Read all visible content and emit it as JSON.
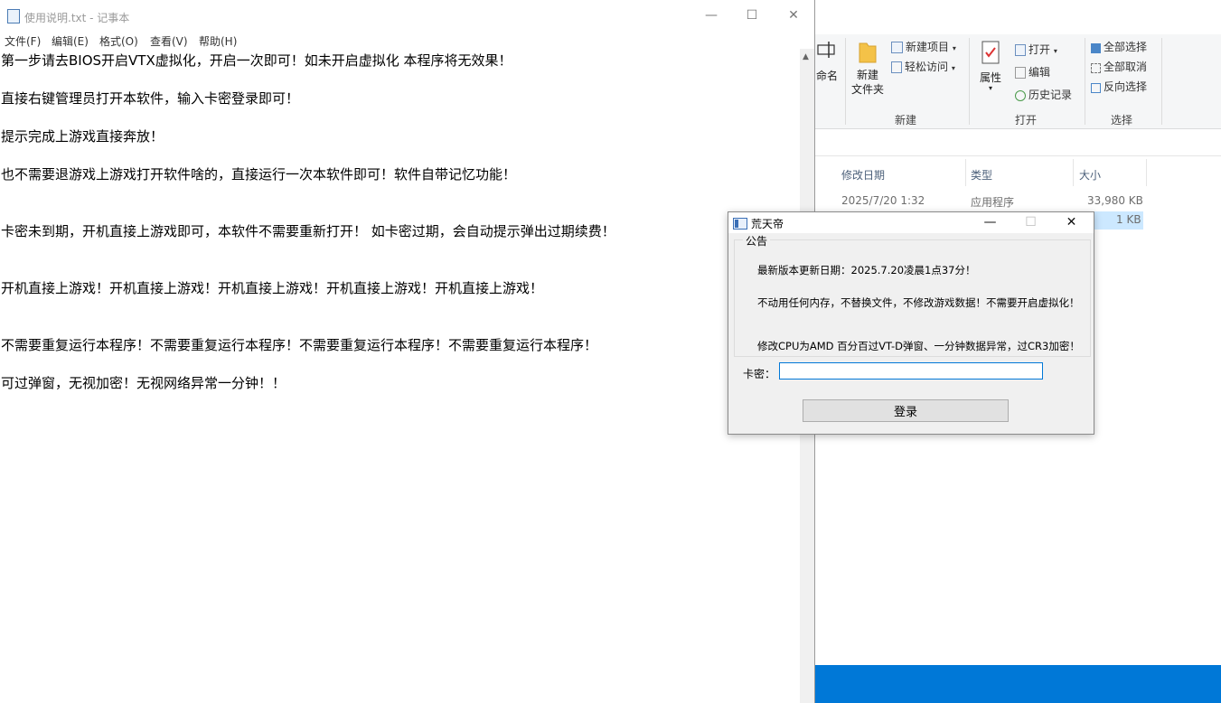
{
  "explorer": {
    "ribbon": {
      "rename_partial": "命名",
      "new_folder": "新建\n文件夹",
      "new_item": "新建项目",
      "easy_access": "轻松访问",
      "properties": "属性",
      "open": "打开",
      "edit": "编辑",
      "history": "历史记录",
      "select_all": "全部选择",
      "select_none": "全部取消",
      "invert_selection": "反向选择",
      "group_new": "新建",
      "group_open": "打开",
      "group_select": "选择"
    },
    "columns": [
      "修改日期",
      "类型",
      "大小"
    ],
    "rows": [
      {
        "date": "2025/7/20 1:32",
        "type": "应用程序",
        "size": "33,980 KB"
      },
      {
        "date": "",
        "type": "",
        "size": "1 KB"
      }
    ]
  },
  "notepad": {
    "title": "使用说明.txt - 记事本",
    "menu": [
      "文件(F)",
      "编辑(E)",
      "格式(O)",
      "查看(V)",
      "帮助(H)"
    ],
    "lines": [
      "第一步请去BIOS开启VTX虚拟化，开启一次即可！如未开启虚拟化 本程序将无效果！",
      "直接右键管理员打开本软件，输入卡密登录即可！",
      "提示完成上游戏直接奔放！",
      "也不需要退游戏上游戏打开软件啥的，直接运行一次本软件即可！软件自带记忆功能！",
      "卡密未到期，开机直接上游戏即可，本软件不需要重新打开！  如卡密过期，会自动提示弹出过期续费！",
      "开机直接上游戏！开机直接上游戏！开机直接上游戏！开机直接上游戏！开机直接上游戏！",
      "不需要重复运行本程序！不需要重复运行本程序！不需要重复运行本程序！不需要重复运行本程序！",
      "可过弹窗，无视加密！无视网络异常一分钟！！"
    ]
  },
  "dialog": {
    "title": "荒天帝",
    "group_label": "公告",
    "notices": [
      "最新版本更新日期：2025.7.20凌晨1点37分！",
      "不动用任何内存，不替换文件，不修改游戏数据！不需要开启虚拟化！",
      "修改CPU为AMD 百分百过VT-D弹窗、一分钟数据异常，过CR3加密！"
    ],
    "key_label": "卡密：",
    "key_value": "",
    "login_button": "登录"
  },
  "window_controls": {
    "minimize": "—",
    "maximize": "☐",
    "close": "✕"
  },
  "colors": {
    "desktop": "#0078d7",
    "accent": "#0078d7",
    "selection": "#cce8ff"
  }
}
